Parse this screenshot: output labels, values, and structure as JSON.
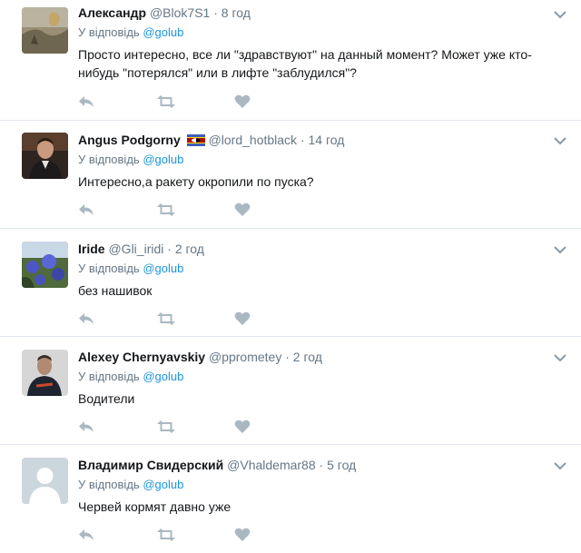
{
  "tweets": [
    {
      "name": "Александр",
      "handle": "@Blok7S1",
      "separator": "·",
      "time": "8 год",
      "reply_prefix": "У відповідь",
      "reply_to": "@golub",
      "text": "Просто интересно, все ли \"здравствуют\" на данный момент? Может уже кто-нибудь \"потерялся\" или в лифте \"заблудился\"?",
      "avatar_icon": "fire-landscape-avatar"
    },
    {
      "name": "Angus Podgorny",
      "flag_icon": "swaziland-flag-icon",
      "handle": "@lord_hotblack",
      "separator": "·",
      "time": "14 год",
      "reply_prefix": "У відповідь",
      "reply_to": "@golub",
      "text": "Интересно,а ракету окропили по пуска?",
      "avatar_icon": "man-portrait-avatar"
    },
    {
      "name": "Iride",
      "handle": "@Gli_iridi",
      "separator": "·",
      "time": "2 год",
      "reply_prefix": "У відповідь",
      "reply_to": "@golub",
      "text": "без нашивок",
      "avatar_icon": "flowers-avatar"
    },
    {
      "name": "Alexey Chernyavskiy",
      "handle": "@pprometey",
      "separator": "·",
      "time": "2 год",
      "reply_prefix": "У відповідь",
      "reply_to": "@golub",
      "text": "Водители",
      "avatar_icon": "person-dark-avatar"
    },
    {
      "name": "Владимир Свидерский",
      "handle": "@Vhaldemar88",
      "separator": "·",
      "time": "5 год",
      "reply_prefix": "У відповідь",
      "reply_to": "@golub",
      "text": "Червей кормят давно уже",
      "avatar_icon": "default-profile-avatar"
    }
  ],
  "colors": {
    "accent": "#1b95e0",
    "muted": "#657786",
    "text": "#14171a",
    "icon": "#aab8c2",
    "border": "#e1e8ed"
  },
  "icons": {
    "reply": "reply-icon",
    "retweet": "retweet-icon",
    "like": "heart-icon",
    "more": "chevron-down-icon"
  }
}
